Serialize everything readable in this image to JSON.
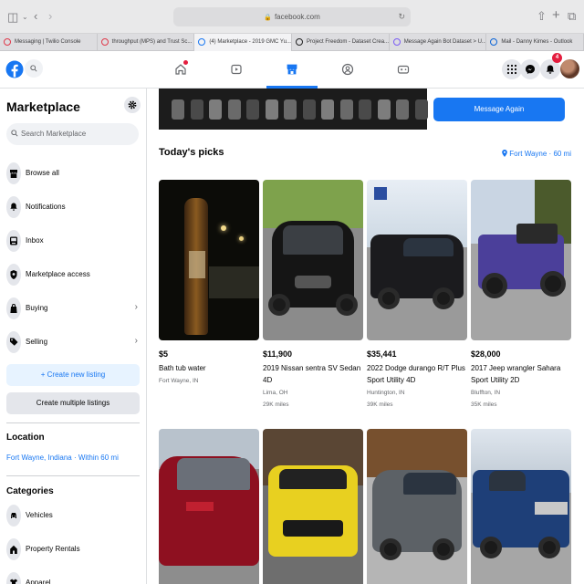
{
  "browser": {
    "url": "facebook.com",
    "tabs": [
      {
        "label": "Messaging | Twilio Console",
        "color": "#e0394a",
        "active": false
      },
      {
        "label": "throughput (MPS) and Trust Sc...",
        "color": "#e0394a",
        "active": false
      },
      {
        "label": "(4) Marketplace - 2019 GMC Yu...",
        "color": "#1877f2",
        "active": true
      },
      {
        "label": "Project Freedom - Dataset Crea...",
        "color": "#222222",
        "active": false
      },
      {
        "label": "Message Again Bot Dataset > U...",
        "color": "#7b5cf5",
        "active": false
      },
      {
        "label": "Mail - Danny Kimes - Outlook",
        "color": "#0a64d8",
        "active": false
      }
    ]
  },
  "header": {
    "notification_count": "4"
  },
  "sidebar": {
    "title": "Marketplace",
    "search_placeholder": "Search Marketplace",
    "items": [
      {
        "label": "Browse all",
        "icon": "storefront-icon"
      },
      {
        "label": "Notifications",
        "icon": "bell-icon"
      },
      {
        "label": "Inbox",
        "icon": "inbox-icon"
      },
      {
        "label": "Marketplace access",
        "icon": "shield-icon"
      },
      {
        "label": "Buying",
        "icon": "shopping-bag-icon"
      },
      {
        "label": "Selling",
        "icon": "tag-icon"
      }
    ],
    "create_listing_label": "+ Create new listing",
    "create_multiple_label": "Create multiple listings",
    "location_heading": "Location",
    "location_value": "Fort Wayne, Indiana · Within 60 mi",
    "categories_heading": "Categories",
    "categories": [
      {
        "label": "Vehicles",
        "icon": "car-icon"
      },
      {
        "label": "Property Rentals",
        "icon": "house-icon"
      },
      {
        "label": "Apparel",
        "icon": "shirt-icon"
      }
    ]
  },
  "main": {
    "message_again_label": "Message Again",
    "picks_title": "Today's picks",
    "picks_location": "Fort Wayne · 60 mi",
    "listings": [
      {
        "price": "$5",
        "title": "Bath tub water",
        "location": "Fort Wayne, IN",
        "miles": ""
      },
      {
        "price": "$11,900",
        "title": "2019 Nissan sentra SV Sedan 4D",
        "location": "Lima, OH",
        "miles": "29K miles"
      },
      {
        "price": "$35,441",
        "title": "2022 Dodge durango R/T Plus Sport Utility 4D",
        "location": "Huntington, IN",
        "miles": "39K miles"
      },
      {
        "price": "$28,000",
        "title": "2017 Jeep wrangler Sahara Sport Utility 2D",
        "location": "Bluffton, IN",
        "miles": "35K miles"
      },
      {
        "price": "",
        "title": "",
        "location": "",
        "miles": ""
      },
      {
        "price": "",
        "title": "",
        "location": "",
        "miles": ""
      },
      {
        "price": "",
        "title": "",
        "location": "",
        "miles": ""
      },
      {
        "price": "",
        "title": "",
        "location": "",
        "miles": ""
      }
    ]
  },
  "colors": {
    "accent": "#1877f2",
    "badge": "#e41e3f"
  }
}
